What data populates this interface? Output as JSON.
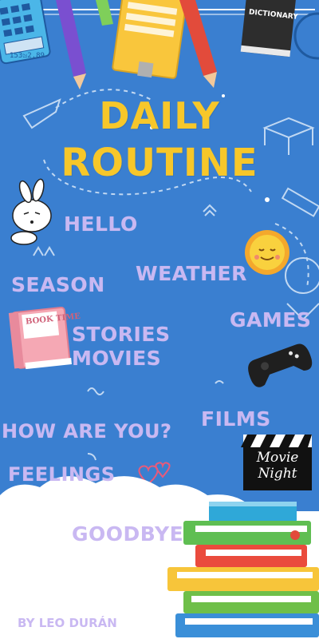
{
  "title": {
    "line1": "DAILY",
    "line2": "ROUTINE"
  },
  "topics": {
    "hello": "HELLO",
    "weather": "WEATHER",
    "season": "SEASON",
    "games": "GAMES",
    "stories": "STORIES",
    "movies": "MOVIES",
    "films": "FILMS",
    "how_are_you": "HOW ARE YOU?",
    "feelings": "FEELINGS",
    "goodbye": "GOODBYE"
  },
  "stickers": {
    "book_time": "BOOK TIME",
    "movie_night_1": "Movie",
    "movie_night_2": "Night",
    "dictionary": "DICTIONARY",
    "calculator_display": "153ಜ2.89"
  },
  "credit": "BY LEO DURÁN",
  "colors": {
    "background": "#3a7fd0",
    "title": "#f7c72a",
    "label": "#c9b8f2",
    "cloud": "#ffffff"
  }
}
